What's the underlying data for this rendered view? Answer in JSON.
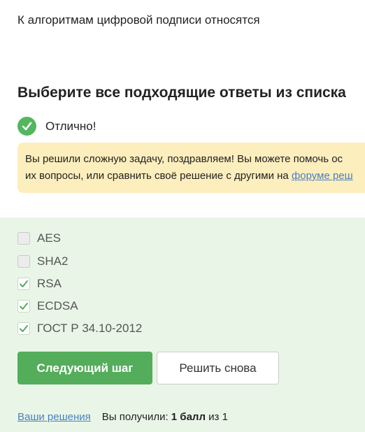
{
  "question": {
    "text": "К алгоритмам цифровой подписи относятся"
  },
  "instructions": {
    "text": "Выберите все подходящие ответы из списка"
  },
  "result": {
    "status": "Отлично!",
    "icon": "check-circle-icon",
    "color": "#54b65e"
  },
  "notice": {
    "line1": "Вы решили сложную задачу, поздравляем! Вы можете помочь ос",
    "line2_prefix": "их вопросы, или сравнить своё решение с другими на ",
    "link": "форуме реш"
  },
  "options": [
    {
      "label": "AES",
      "checked": false
    },
    {
      "label": "SHA2",
      "checked": false
    },
    {
      "label": "RSA",
      "checked": true
    },
    {
      "label": "ECDSA",
      "checked": true
    },
    {
      "label": "ГОСТ Р 34.10-2012",
      "checked": true
    }
  ],
  "buttons": {
    "next": "Следующий шаг",
    "retry": "Решить снова"
  },
  "footer": {
    "solutions_link": "Ваши решения",
    "received_prefix": "Вы получили:",
    "points": "1 балл",
    "of_text": "из 1"
  },
  "colors": {
    "accent_green": "#54ad5b",
    "answers_background": "#e9f6e7",
    "notice_background": "#fdeebd",
    "link": "#4a7fc1"
  }
}
